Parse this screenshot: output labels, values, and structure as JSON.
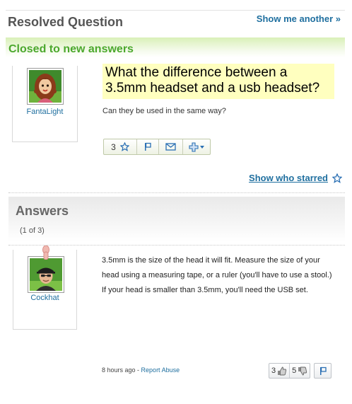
{
  "header": {
    "title": "Resolved Question",
    "show_another": "Show me another »"
  },
  "status": {
    "label": "Closed to new answers"
  },
  "question": {
    "asker_name": "FantaLight",
    "title": "What the difference between a 3.5mm headset and a usb headset?",
    "body": "Can they be used in the same way?",
    "star_count": "3",
    "actions": [
      "star-icon",
      "flag-icon",
      "email-icon",
      "plus-icon"
    ]
  },
  "show_who_starred": "Show who starred",
  "answers": {
    "heading": "Answers",
    "count_label": "(1 of 3)",
    "items": [
      {
        "author": "Cockhat",
        "text": "3.5mm is the size of the head it will fit. Measure the size of your head using a measuring tape, or a ruler (you'll have to use a stool.) If your head is smaller than 3.5mm, you'll need the USB set.",
        "time": "8 hours ago",
        "separator": " - ",
        "report_label": "Report Abuse",
        "thumbs_up": "3",
        "thumbs_down": "5"
      }
    ]
  },
  "colors": {
    "link": "#1f6f9f",
    "status_green": "#4ba82c",
    "title_highlight": "#ffffbf"
  }
}
